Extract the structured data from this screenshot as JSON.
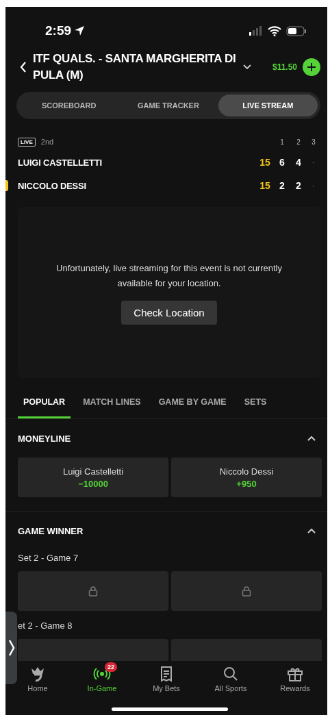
{
  "status_bar": {
    "time": "2:59"
  },
  "header": {
    "title": "ITF QUALS. - SANTA MARGHERITA DI PULA (M)",
    "balance": "$11.50"
  },
  "view_tabs": [
    {
      "label": "SCOREBOARD",
      "selected": false
    },
    {
      "label": "GAME TRACKER",
      "selected": false
    },
    {
      "label": "LIVE STREAM",
      "selected": true
    }
  ],
  "scoreboard": {
    "live_badge": "LIVE",
    "period": "2nd",
    "set_headers": [
      "1",
      "2",
      "3"
    ],
    "players": [
      {
        "name": "LUIGI CASTELLETTI",
        "serving": false,
        "point": "15",
        "sets": [
          "6",
          "4",
          "-"
        ]
      },
      {
        "name": "NICCOLO DESSI",
        "serving": true,
        "point": "15",
        "sets": [
          "2",
          "2",
          "-"
        ]
      }
    ]
  },
  "stream": {
    "message": "Unfortunately, live streaming for this event is not currently available for your location.",
    "button": "Check Location"
  },
  "market_tabs": [
    {
      "label": "POPULAR",
      "selected": true
    },
    {
      "label": "MATCH LINES",
      "selected": false
    },
    {
      "label": "GAME BY GAME",
      "selected": false
    },
    {
      "label": "SETS",
      "selected": false
    }
  ],
  "markets": [
    {
      "title": "MONEYLINE",
      "expanded": true,
      "groups": [
        {
          "outcomes": [
            {
              "kind": "odds",
              "name": "Luigi Castelletti",
              "odds": "−10000"
            },
            {
              "kind": "odds",
              "name": "Niccolo Dessi",
              "odds": "+950"
            }
          ]
        }
      ]
    },
    {
      "title": "GAME WINNER",
      "expanded": true,
      "groups": [
        {
          "label": "Set 2 - Game 7",
          "outcomes": [
            {
              "kind": "locked"
            },
            {
              "kind": "locked"
            }
          ]
        },
        {
          "label": "et 2 - Game 8",
          "outcomes": [
            {
              "kind": "covered"
            },
            {
              "kind": "covered"
            }
          ]
        }
      ]
    }
  ],
  "nav": [
    {
      "label": "Home",
      "selected": false
    },
    {
      "label": "In-Game",
      "selected": true,
      "badge": "22"
    },
    {
      "label": "My Bets",
      "selected": false
    },
    {
      "label": "All Sports",
      "selected": false
    },
    {
      "label": "Rewards",
      "selected": false
    }
  ]
}
